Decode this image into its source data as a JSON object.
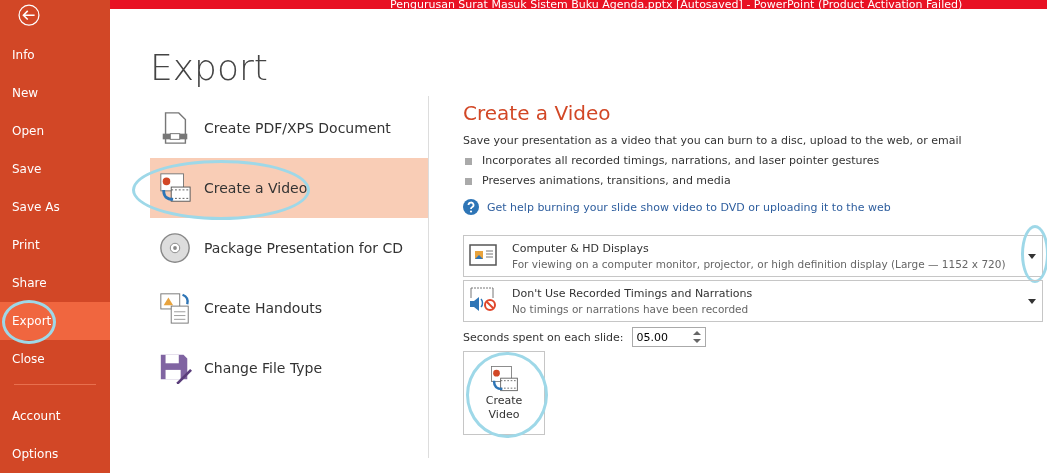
{
  "window": {
    "title": "Pengurusan Surat Masuk Sistem Buku Agenda.pptx [Autosaved] -  PowerPoint (Product Activation Failed)"
  },
  "sidebar": {
    "items": [
      {
        "label": "Info",
        "selected": false,
        "circled": false
      },
      {
        "label": "New",
        "selected": false,
        "circled": false
      },
      {
        "label": "Open",
        "selected": false,
        "circled": false
      },
      {
        "label": "Save",
        "selected": false,
        "circled": false
      },
      {
        "label": "Save As",
        "selected": false,
        "circled": false
      },
      {
        "label": "Print",
        "selected": false,
        "circled": false
      },
      {
        "label": "Share",
        "selected": false,
        "circled": false
      },
      {
        "label": "Export",
        "selected": true,
        "circled": true
      },
      {
        "label": "Close",
        "selected": false,
        "circled": false
      }
    ],
    "bottom_items": [
      {
        "label": "Account"
      },
      {
        "label": "Options"
      }
    ]
  },
  "heading": "Export",
  "options": [
    {
      "kind": "pdf",
      "label": "Create PDF/XPS Document",
      "selected": false,
      "circled": false
    },
    {
      "kind": "video",
      "label": "Create a Video",
      "selected": true,
      "circled": true
    },
    {
      "kind": "cd",
      "label": "Package Presentation for CD",
      "selected": false,
      "circled": false
    },
    {
      "kind": "handouts",
      "label": "Create Handouts",
      "selected": false,
      "circled": false
    },
    {
      "kind": "filetype",
      "label": "Change File Type",
      "selected": false,
      "circled": false
    }
  ],
  "detail": {
    "title": "Create a Video",
    "description": "Save your presentation as a video that you can burn to a disc, upload to the web, or email",
    "bullets": [
      "Incorporates all recorded timings, narrations, and laser pointer gestures",
      "Preserves animations, transitions, and media"
    ],
    "help_link": "Get help burning your slide show video to DVD or uploading it to the web",
    "dropdowns": [
      {
        "kind": "display",
        "title": "Computer & HD Displays",
        "subtitle": "For viewing on a computer monitor, projector, or high definition display  (Large — 1152 x 720)",
        "circled": true
      },
      {
        "kind": "narration",
        "title": "Don't Use Recorded Timings and Narrations",
        "subtitle": "No timings or narrations have been recorded",
        "circled": false
      }
    ],
    "seconds": {
      "label": "Seconds spent on each slide:",
      "value": "05.00"
    },
    "create_button": {
      "label_lines": [
        "Create",
        "Video"
      ],
      "circled": true
    }
  }
}
